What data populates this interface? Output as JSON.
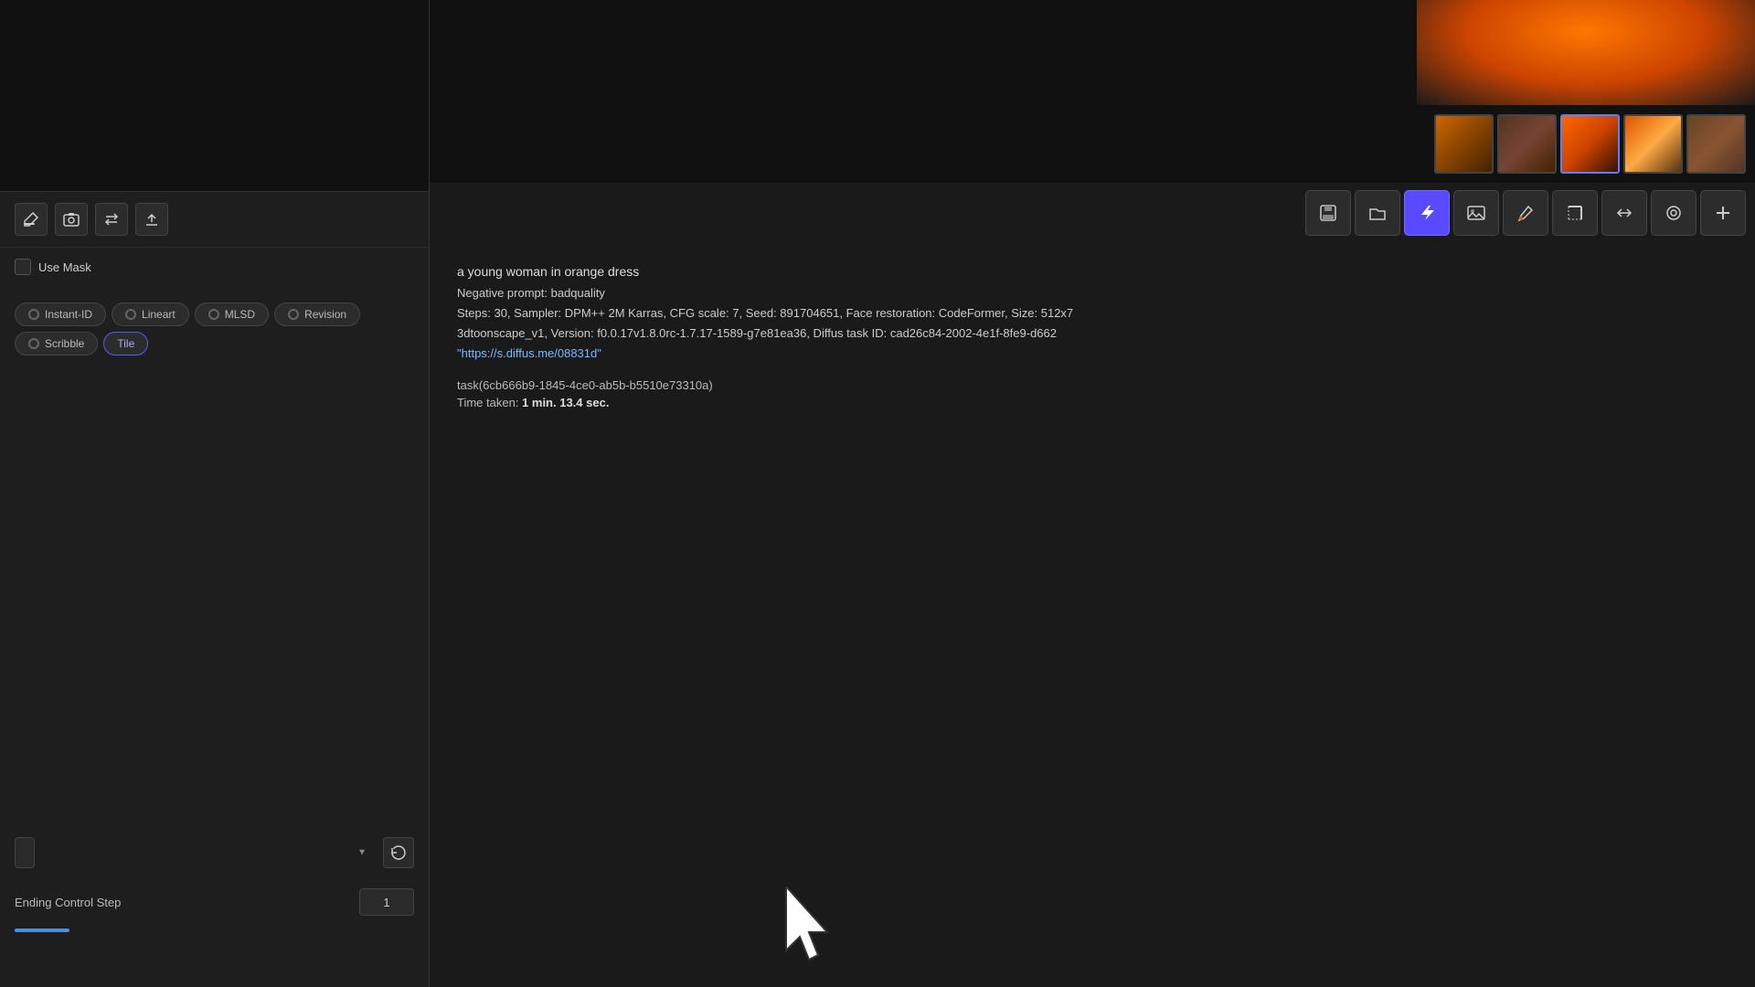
{
  "leftPanel": {
    "toolbar": {
      "editIcon": "✏️",
      "cameraIcon": "📷",
      "swapIcon": "⇄",
      "uploadIcon": "↑"
    },
    "useMask": {
      "label": "Use Mask"
    },
    "controlTypes": [
      {
        "id": "instant-id",
        "label": "Instant-ID",
        "active": false
      },
      {
        "id": "lineart",
        "label": "Lineart",
        "active": false
      },
      {
        "id": "mlsd",
        "label": "MLSD",
        "active": false
      },
      {
        "id": "revision",
        "label": "Revision",
        "active": false
      },
      {
        "id": "scribble",
        "label": "Scribble",
        "active": false
      },
      {
        "id": "tile",
        "label": "Tile",
        "active": true
      }
    ],
    "dropdown": {
      "placeholder": ""
    },
    "endingControlStep": {
      "label": "Ending Control Step",
      "value": "1"
    }
  },
  "mainArea": {
    "imageToolbar": {
      "tools": [
        {
          "id": "save",
          "icon": "💾",
          "active": false
        },
        {
          "id": "folder",
          "icon": "📁",
          "active": false
        },
        {
          "id": "lightning",
          "icon": "⚡",
          "active": true
        },
        {
          "id": "image",
          "icon": "🖼",
          "active": false
        },
        {
          "id": "brush",
          "icon": "🖌",
          "active": false
        },
        {
          "id": "crop",
          "icon": "↗",
          "active": false
        },
        {
          "id": "arrows",
          "icon": "⇉",
          "active": false
        },
        {
          "id": "circle",
          "icon": "◎",
          "active": false
        },
        {
          "id": "plus",
          "icon": "✚",
          "active": false
        }
      ]
    },
    "infoText": {
      "prompt": "a young woman in orange dress",
      "negativePrompt": "Negative prompt: badquality",
      "steps": "Steps: 30, Sampler: DPM++ 2M Karras, CFG scale: 7, Seed: 891704651, Face restoration: CodeFormer, Size: 512x7",
      "model": "3dtoonscape_v1, Version: f0.0.17v1.8.0rc-1.7.17-1589-g7e81ea36, Diffus task ID: cad26c84-2002-4e1f-8fe9-d662",
      "url": "\"https://s.diffus.me/08831d\"",
      "task": "task(6cb666b9-1845-4ce0-ab5b-b5510e73310a)",
      "timeTaken": "Time taken: ",
      "timeBold": "1 min. 13.4 sec."
    }
  }
}
